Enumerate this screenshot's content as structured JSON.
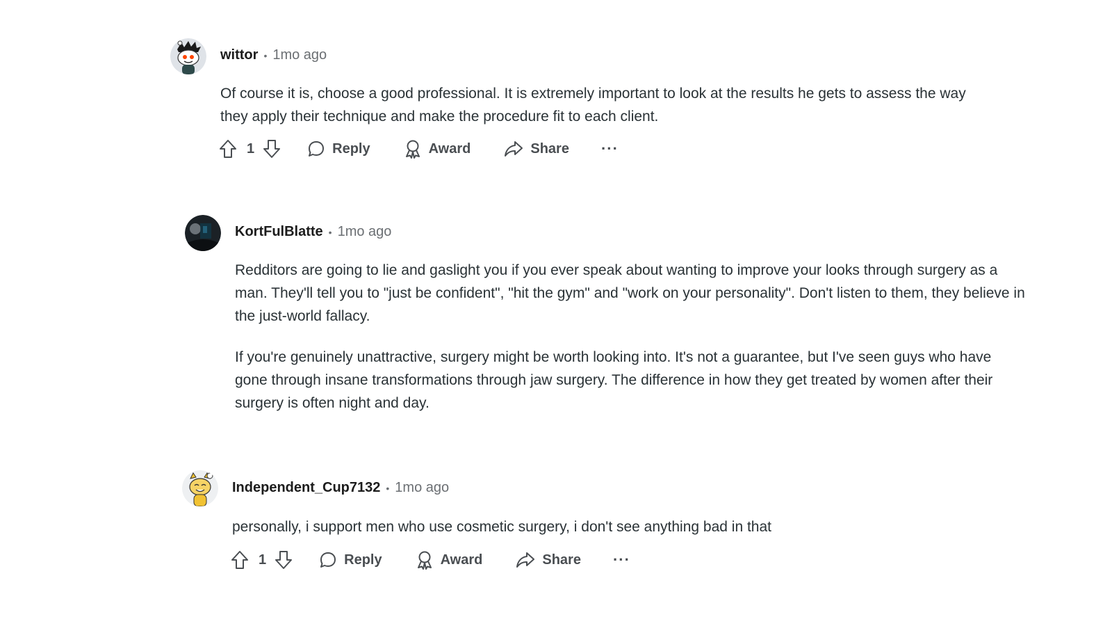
{
  "comments": [
    {
      "username": "wittor",
      "time": "1mo ago",
      "body": [
        "Of course it is, choose a good professional. It is extremely important to look at the results he gets to assess the way they apply their technique and make the procedure fit to each client."
      ],
      "votes": "1",
      "actions": {
        "reply": "Reply",
        "award": "Award",
        "share": "Share",
        "more": "···"
      }
    },
    {
      "username": "KortFulBlatte",
      "time": "1mo ago",
      "body": [
        "Redditors are going to lie and gaslight you if you ever speak about wanting to improve your looks through surgery as a man. They'll tell you to \"just be confident\", \"hit the gym\" and \"work on your personality\". Don't listen to them, they believe in the just-world fallacy.",
        "If you're genuinely unattractive, surgery might be worth looking into. It's not a guarantee, but I've seen guys who have gone through insane transformations through jaw surgery. The difference in how they get treated by women after their surgery is often night and day."
      ]
    },
    {
      "username": "Independent_Cup7132",
      "time": "1mo ago",
      "body": [
        "personally, i support men who use cosmetic surgery, i don't see anything bad in that"
      ],
      "votes": "1",
      "actions": {
        "reply": "Reply",
        "award": "Award",
        "share": "Share",
        "more": "···"
      }
    }
  ],
  "icons": {
    "upvote": "upvote-arrow-icon",
    "downvote": "downvote-arrow-icon",
    "reply": "speech-bubble-icon",
    "award": "award-ribbon-icon",
    "share": "share-arrow-icon",
    "more": "more-dots-icon"
  },
  "colors": {
    "username": "#1c1c1c",
    "meta": "#6b6f73",
    "body": "#2a3236",
    "action": "#4a4e52"
  }
}
